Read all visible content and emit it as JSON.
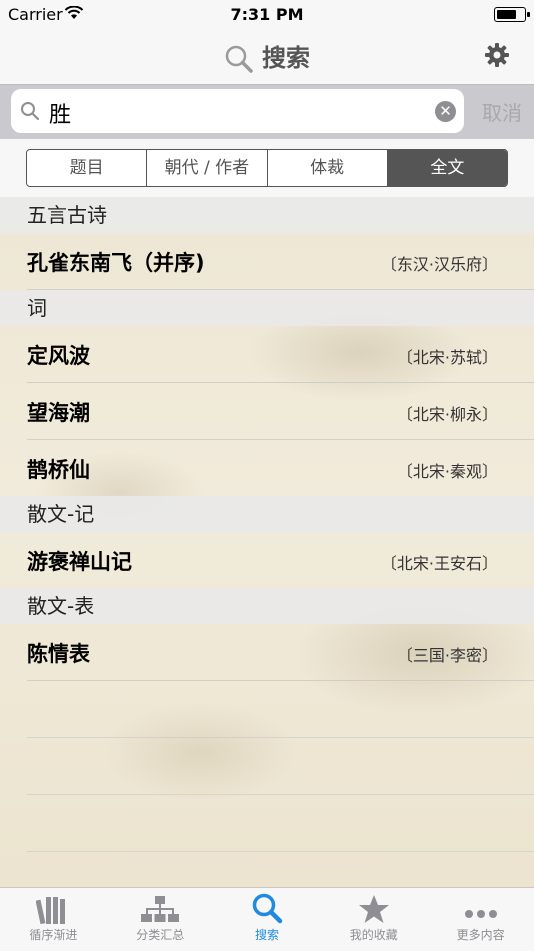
{
  "status": {
    "carrier": "Carrier",
    "time": "7:31 PM"
  },
  "nav": {
    "title": "搜索"
  },
  "search": {
    "value": "胜",
    "cancel": "取消"
  },
  "segments": [
    "题目",
    "朝代 / 作者",
    "体裁",
    "全文"
  ],
  "sections": [
    {
      "header": "五言古诗",
      "rows": [
        {
          "title": "孔雀东南飞（并序)",
          "author": "〔东汉·汉乐府〕"
        }
      ]
    },
    {
      "header": "词",
      "rows": [
        {
          "title": "定风波",
          "author": "〔北宋·苏轼〕"
        },
        {
          "title": "望海潮",
          "author": "〔北宋·柳永〕"
        },
        {
          "title": "鹊桥仙",
          "author": "〔北宋·秦观〕"
        }
      ]
    },
    {
      "header": "散文-记",
      "rows": [
        {
          "title": "游褒禅山记",
          "author": "〔北宋·王安石〕"
        }
      ]
    },
    {
      "header": "散文-表",
      "rows": [
        {
          "title": "陈情表",
          "author": "〔三国·李密〕"
        }
      ]
    }
  ],
  "tabs": [
    {
      "label": "循序渐进",
      "icon": "books-icon"
    },
    {
      "label": "分类汇总",
      "icon": "hierarchy-icon"
    },
    {
      "label": "搜索",
      "icon": "search-icon"
    },
    {
      "label": "我的收藏",
      "icon": "star-icon"
    },
    {
      "label": "更多内容",
      "icon": "more-icon"
    }
  ],
  "colors": {
    "accent": "#1e8be0",
    "segment_active": "#555555"
  }
}
